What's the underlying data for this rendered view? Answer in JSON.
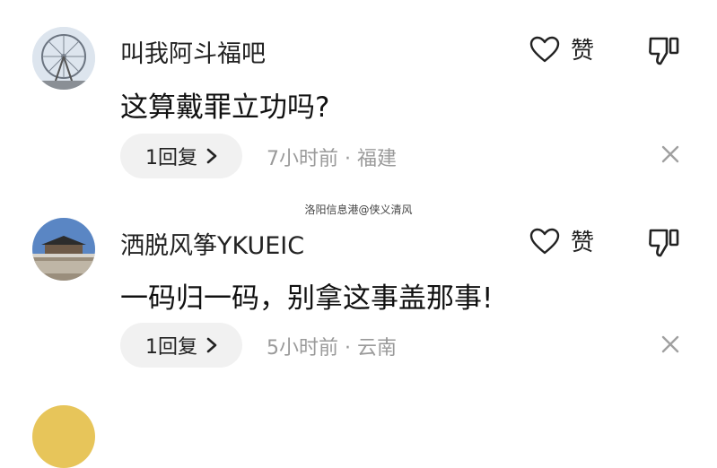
{
  "comments": [
    {
      "username": "叫我阿斗福吧",
      "content": "这算戴罪立功吗?",
      "like_label": "赞",
      "reply_label": "1回复",
      "meta": "7小时前 · 福建",
      "avatar_icon": "ferris-wheel-avatar"
    },
    {
      "username": "洒脱风筝YKUEIC",
      "content": "一码归一码，别拿这事盖那事!",
      "like_label": "赞",
      "reply_label": "1回复",
      "meta": "5小时前 · 云南",
      "avatar_icon": "temple-avatar"
    }
  ],
  "watermark": "洛阳信息港@侠义清风",
  "icons": {
    "like": "heart-icon",
    "dislike": "thumbs-down-icon",
    "reply": "chevron-right-icon",
    "close": "close-icon"
  }
}
